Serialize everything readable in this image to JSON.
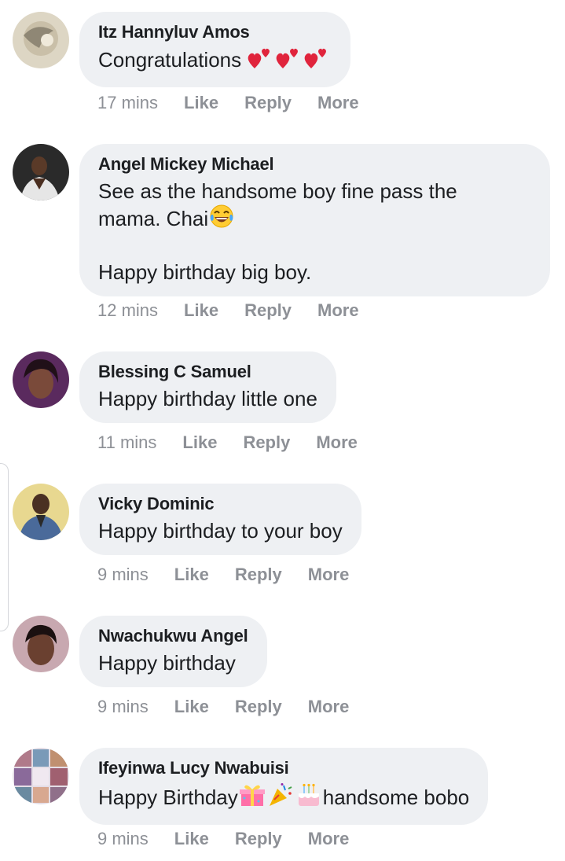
{
  "comments": [
    {
      "author": "Itz Hannyluv Amos",
      "text": "Congratulations",
      "time": "17 mins",
      "like": "Like",
      "reply": "Reply",
      "more": "More",
      "emojis": [
        "heart-icon",
        "heart-icon",
        "heart-icon"
      ]
    },
    {
      "author": "Angel Mickey Michael",
      "text_line1": "See as the handsome boy fine pass the",
      "text_line2": "mama. Chai",
      "text_line3": "Happy birthday big boy.",
      "time": "12 mins",
      "like": "Like",
      "reply": "Reply",
      "more": "More",
      "emojis": [
        "tears-of-joy-icon"
      ]
    },
    {
      "author": "Blessing C Samuel",
      "text": "Happy birthday little one",
      "time": "11 mins",
      "like": "Like",
      "reply": "Reply",
      "more": "More"
    },
    {
      "author": "Vicky Dominic",
      "text": "Happy birthday to your boy",
      "time": "9 mins",
      "like": "Like",
      "reply": "Reply",
      "more": "More"
    },
    {
      "author": "Nwachukwu Angel",
      "text": "Happy birthday",
      "time": "9 mins",
      "like": "Like",
      "reply": "Reply",
      "more": "More"
    },
    {
      "author": "Ifeyinwa Lucy Nwabuisi",
      "text_before": "Happy Birthday",
      "text_after": "handsome bobo",
      "time": "9 mins",
      "like": "Like",
      "reply": "Reply",
      "more": "More",
      "emojis": [
        "wrapped-gift-icon",
        "party-popper-icon",
        "birthday-cake-icon"
      ]
    }
  ],
  "colors": {
    "bubble": "#eef0f3",
    "author_text": "#1c1e21",
    "meta_text": "#8d9096",
    "heart": "#e0243c"
  }
}
